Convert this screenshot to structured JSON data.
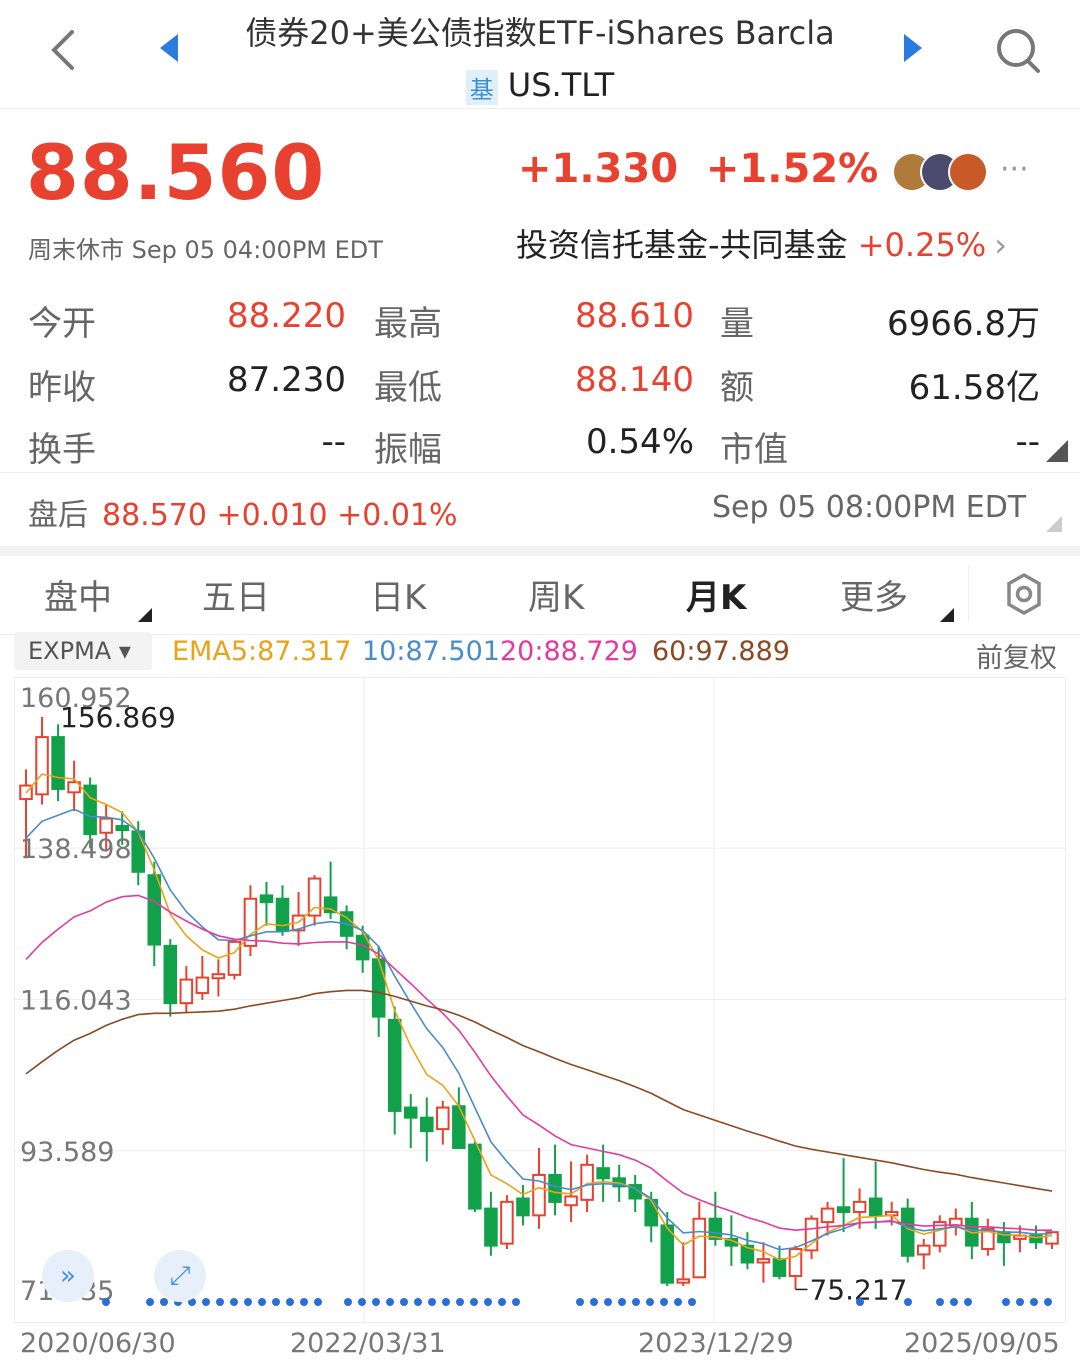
{
  "header": {
    "title": "债券20+美公债指数ETF-iShares Barcla",
    "badge": "基",
    "code": "US.TLT"
  },
  "quote": {
    "price": "88.560",
    "status": "周末休市 Sep 05 04:00PM EDT",
    "change": "+1.330",
    "change_pct": "+1.52%",
    "more": "···",
    "category": "投资信托基金-共同基金",
    "category_pct": "+0.25%",
    "category_chevron": "›"
  },
  "stats": {
    "open_label": "今开",
    "open": "88.220",
    "high_label": "最高",
    "high": "88.610",
    "volume_label": "量",
    "volume": "6966.8万",
    "prev_label": "昨收",
    "prev": "87.230",
    "low_label": "最低",
    "low": "88.140",
    "amount_label": "额",
    "amount": "61.58亿",
    "turnover_label": "换手",
    "turnover": "--",
    "amplitude_label": "振幅",
    "amplitude": "0.54%",
    "mcap_label": "市值",
    "mcap": "--"
  },
  "after_hours": {
    "label": "盘后",
    "value": "88.570 +0.010 +0.01%",
    "time": "Sep 05 08:00PM EDT"
  },
  "tabs": [
    "盘中",
    "五日",
    "日K",
    "周K",
    "月K",
    "更多"
  ],
  "active_tab": "月K",
  "indicators": {
    "selector": "EXPMA ▾",
    "ema5": "EMA5:87.317",
    "ema10": "10:87.501",
    "ema20": "20:88.729",
    "ema60": "60:97.889",
    "adjust": "前复权"
  },
  "colors": {
    "up": "#e8412f",
    "down": "#12a14b",
    "ema5": "#e9a319",
    "ema10": "#4a8cc8",
    "ema20": "#e23ba0",
    "ema60": "#8a4a22",
    "accent": "#2a7be0"
  },
  "chart_data": {
    "type": "candlestick",
    "y_ticks": [
      "160.952",
      "138.498",
      "116.043",
      "93.589",
      "71.135"
    ],
    "x_ticks": [
      "2020/06/30",
      "2022/03/31",
      "2023/12/29",
      "2025/09/05"
    ],
    "ylim": [
      71.135,
      160.952
    ],
    "max_label": "156.869",
    "min_label": "75.217",
    "candles": [
      {
        "o": 145.8,
        "h": 150.2,
        "l": 137.0,
        "c": 147.8
      },
      {
        "o": 146.5,
        "h": 158.0,
        "l": 145.0,
        "c": 155.0
      },
      {
        "o": 155.0,
        "h": 156.9,
        "l": 145.5,
        "c": 147.3
      },
      {
        "o": 146.8,
        "h": 151.5,
        "l": 144.0,
        "c": 148.3
      },
      {
        "o": 147.8,
        "h": 149.0,
        "l": 138.5,
        "c": 140.6
      },
      {
        "o": 140.8,
        "h": 145.0,
        "l": 138.0,
        "c": 142.9
      },
      {
        "o": 141.8,
        "h": 144.0,
        "l": 139.0,
        "c": 141.2
      },
      {
        "o": 141.0,
        "h": 142.5,
        "l": 133.0,
        "c": 135.0
      },
      {
        "o": 134.5,
        "h": 136.5,
        "l": 121.0,
        "c": 124.2
      },
      {
        "o": 124.0,
        "h": 125.0,
        "l": 113.5,
        "c": 115.5
      },
      {
        "o": 115.5,
        "h": 121.0,
        "l": 114.0,
        "c": 119.0
      },
      {
        "o": 117.0,
        "h": 122.5,
        "l": 116.0,
        "c": 119.3
      },
      {
        "o": 119.2,
        "h": 122.0,
        "l": 116.5,
        "c": 119.8
      },
      {
        "o": 119.7,
        "h": 124.5,
        "l": 119.0,
        "c": 124.6
      },
      {
        "o": 124.0,
        "h": 133.0,
        "l": 122.5,
        "c": 131.0
      },
      {
        "o": 131.5,
        "h": 133.5,
        "l": 127.0,
        "c": 130.5
      },
      {
        "o": 131.0,
        "h": 133.0,
        "l": 125.5,
        "c": 126.2
      },
      {
        "o": 126.3,
        "h": 132.0,
        "l": 124.0,
        "c": 128.5
      },
      {
        "o": 128.5,
        "h": 134.5,
        "l": 127.0,
        "c": 134.0
      },
      {
        "o": 131.2,
        "h": 136.5,
        "l": 128.0,
        "c": 129.0
      },
      {
        "o": 129.0,
        "h": 130.0,
        "l": 123.5,
        "c": 125.5
      },
      {
        "o": 125.5,
        "h": 127.0,
        "l": 120.0,
        "c": 122.0
      },
      {
        "o": 122.0,
        "h": 124.0,
        "l": 110.5,
        "c": 113.5
      },
      {
        "o": 113.0,
        "h": 115.0,
        "l": 96.0,
        "c": 99.5
      },
      {
        "o": 100.0,
        "h": 102.0,
        "l": 94.0,
        "c": 98.5
      },
      {
        "o": 98.5,
        "h": 101.5,
        "l": 92.0,
        "c": 96.5
      },
      {
        "o": 96.8,
        "h": 101.0,
        "l": 94.5,
        "c": 100.0
      },
      {
        "o": 100.2,
        "h": 103.0,
        "l": 94.0,
        "c": 94.0
      },
      {
        "o": 94.5,
        "h": 95.0,
        "l": 84.5,
        "c": 85.0
      },
      {
        "o": 85.0,
        "h": 87.5,
        "l": 78.0,
        "c": 79.5
      },
      {
        "o": 79.8,
        "h": 87.0,
        "l": 79.0,
        "c": 86.0
      },
      {
        "o": 86.5,
        "h": 88.5,
        "l": 82.5,
        "c": 84.0
      },
      {
        "o": 84.0,
        "h": 94.0,
        "l": 82.0,
        "c": 90.0
      },
      {
        "o": 90.0,
        "h": 94.5,
        "l": 84.0,
        "c": 86.0
      },
      {
        "o": 85.5,
        "h": 92.0,
        "l": 83.0,
        "c": 86.8
      },
      {
        "o": 86.3,
        "h": 93.0,
        "l": 84.5,
        "c": 91.5
      },
      {
        "o": 91.0,
        "h": 94.5,
        "l": 86.0,
        "c": 89.5
      },
      {
        "o": 89.5,
        "h": 91.5,
        "l": 86.0,
        "c": 88.3
      },
      {
        "o": 88.5,
        "h": 90.0,
        "l": 84.5,
        "c": 86.5
      },
      {
        "o": 86.3,
        "h": 87.5,
        "l": 80.0,
        "c": 82.5
      },
      {
        "o": 82.5,
        "h": 84.5,
        "l": 73.5,
        "c": 74.0
      },
      {
        "o": 74.0,
        "h": 80.0,
        "l": 73.5,
        "c": 74.5
      },
      {
        "o": 74.8,
        "h": 86.0,
        "l": 75.2,
        "c": 83.5
      },
      {
        "o": 83.5,
        "h": 87.5,
        "l": 79.5,
        "c": 80.5
      },
      {
        "o": 80.5,
        "h": 84.0,
        "l": 76.5,
        "c": 79.5
      },
      {
        "o": 79.5,
        "h": 81.5,
        "l": 76.0,
        "c": 77.0
      },
      {
        "o": 77.0,
        "h": 80.0,
        "l": 74.0,
        "c": 77.5
      },
      {
        "o": 77.5,
        "h": 79.5,
        "l": 74.5,
        "c": 75.0
      },
      {
        "o": 75.0,
        "h": 79.5,
        "l": 73.0,
        "c": 79.0
      },
      {
        "o": 78.8,
        "h": 84.0,
        "l": 77.5,
        "c": 83.5
      },
      {
        "o": 83.0,
        "h": 86.0,
        "l": 81.0,
        "c": 85.0
      },
      {
        "o": 85.2,
        "h": 92.5,
        "l": 81.5,
        "c": 84.5
      },
      {
        "o": 84.5,
        "h": 88.0,
        "l": 82.0,
        "c": 86.0
      },
      {
        "o": 86.5,
        "h": 92.0,
        "l": 82.0,
        "c": 84.0
      },
      {
        "o": 84.0,
        "h": 86.0,
        "l": 82.5,
        "c": 84.5
      },
      {
        "o": 85.0,
        "h": 86.5,
        "l": 77.0,
        "c": 78.0
      },
      {
        "o": 78.2,
        "h": 80.5,
        "l": 76.0,
        "c": 79.5
      },
      {
        "o": 79.5,
        "h": 84.0,
        "l": 78.5,
        "c": 83.0
      },
      {
        "o": 82.5,
        "h": 85.0,
        "l": 81.0,
        "c": 83.5
      },
      {
        "o": 83.5,
        "h": 86.0,
        "l": 77.5,
        "c": 79.5
      },
      {
        "o": 79.0,
        "h": 83.5,
        "l": 78.0,
        "c": 82.0
      },
      {
        "o": 81.5,
        "h": 83.0,
        "l": 76.5,
        "c": 80.0
      },
      {
        "o": 80.5,
        "h": 82.5,
        "l": 78.5,
        "c": 81.0
      },
      {
        "o": 81.0,
        "h": 82.5,
        "l": 79.0,
        "c": 80.0
      },
      {
        "o": 79.8,
        "h": 81.5,
        "l": 79.0,
        "c": 81.5
      }
    ],
    "ema_series": [
      {
        "name": "EMA5",
        "values": [
          146.7,
          149.5,
          149.0,
          148.8,
          146.0,
          145.0,
          143.8,
          140.9,
          135.3,
          128.7,
          125.5,
          123.4,
          122.2,
          123.0,
          125.7,
          127.3,
          127.0,
          127.5,
          129.7,
          129.5,
          128.2,
          126.1,
          121.9,
          114.4,
          109.1,
          104.9,
          103.3,
          100.2,
          95.1,
          90.0,
          88.7,
          87.1,
          88.1,
          87.4,
          87.2,
          88.7,
          89.0,
          88.8,
          88.0,
          86.2,
          82.1,
          79.6,
          80.9,
          80.8,
          80.3,
          79.2,
          78.6,
          77.4,
          77.9,
          79.8,
          81.5,
          82.5,
          83.7,
          83.8,
          84.0,
          82.0,
          81.2,
          81.8,
          82.4,
          81.4,
          81.6,
          81.1,
          81.1,
          80.7,
          81.0
        ]
      },
      {
        "name": "EMA10",
        "values": [
          140.0,
          142.5,
          143.4,
          144.3,
          143.2,
          143.1,
          142.7,
          141.0,
          137.0,
          132.3,
          129.1,
          126.8,
          124.9,
          124.8,
          125.5,
          126.1,
          126.1,
          126.5,
          127.3,
          127.6,
          127.3,
          126.3,
          123.9,
          119.5,
          115.5,
          111.7,
          108.9,
          105.1,
          100.0,
          94.9,
          92.0,
          89.4,
          89.1,
          88.3,
          87.8,
          88.5,
          88.7,
          88.6,
          88.0,
          86.5,
          83.6,
          81.4,
          81.6,
          81.4,
          81.1,
          80.3,
          79.8,
          78.9,
          79.2,
          80.2,
          81.3,
          82.0,
          82.9,
          83.0,
          83.2,
          82.2,
          81.7,
          82.0,
          82.3,
          81.8,
          81.8,
          81.5,
          81.5,
          81.2,
          81.3
        ]
      },
      {
        "name": "EMA20",
        "values": [
          122.0,
          124.5,
          126.5,
          128.3,
          129.2,
          130.5,
          131.3,
          131.5,
          130.6,
          129.0,
          127.7,
          126.5,
          125.5,
          125.0,
          124.8,
          124.7,
          124.4,
          124.3,
          124.5,
          124.6,
          124.6,
          124.1,
          122.8,
          120.6,
          118.4,
          116.1,
          114.0,
          111.5,
          108.2,
          104.7,
          101.7,
          98.9,
          97.4,
          95.8,
          94.5,
          94.0,
          93.5,
          93.0,
          92.2,
          91.0,
          89.1,
          87.3,
          86.3,
          85.4,
          84.6,
          83.7,
          83.0,
          82.1,
          81.8,
          82.0,
          82.3,
          82.5,
          82.9,
          83.0,
          83.1,
          82.7,
          82.4,
          82.5,
          82.6,
          82.3,
          82.3,
          82.1,
          82.0,
          81.8,
          81.8
        ]
      },
      {
        "name": "EMA60",
        "values": [
          105.0,
          106.8,
          108.5,
          110.0,
          111.0,
          112.2,
          113.1,
          113.8,
          114.0,
          114.0,
          114.1,
          114.2,
          114.3,
          114.6,
          115.1,
          115.5,
          115.9,
          116.3,
          116.9,
          117.2,
          117.4,
          117.4,
          117.1,
          116.5,
          115.8,
          115.1,
          114.5,
          113.7,
          112.7,
          111.5,
          110.4,
          109.2,
          108.3,
          107.3,
          106.4,
          105.6,
          104.8,
          104.0,
          103.1,
          102.1,
          100.9,
          99.7,
          98.9,
          98.1,
          97.3,
          96.5,
          95.8,
          95.0,
          94.3,
          93.8,
          93.4,
          93.0,
          92.6,
          92.2,
          91.8,
          91.3,
          90.8,
          90.4,
          90.1,
          89.6,
          89.2,
          88.8,
          88.4,
          88.0,
          87.6
        ]
      }
    ],
    "grid": true
  }
}
